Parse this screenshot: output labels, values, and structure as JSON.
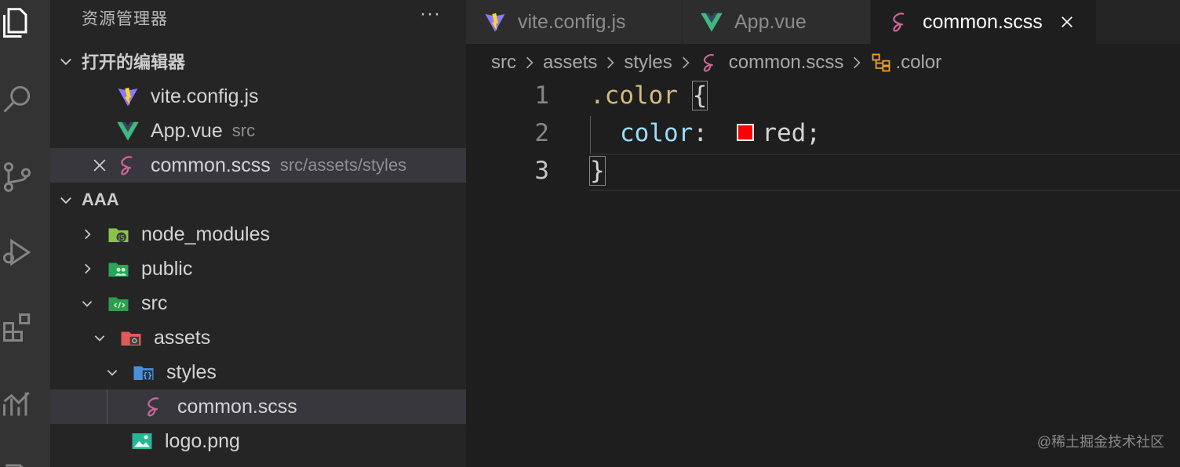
{
  "explorer": {
    "title": "资源管理器",
    "more": "···",
    "open_editors_label": "打开的编辑器",
    "open_editors": [
      {
        "name": "vite.config.js",
        "desc": ""
      },
      {
        "name": "App.vue",
        "desc": "src"
      },
      {
        "name": "common.scss",
        "desc": "src/assets/styles"
      }
    ],
    "workspace_label": "AAA",
    "tree": [
      {
        "name": "node_modules"
      },
      {
        "name": "public"
      },
      {
        "name": "src"
      },
      {
        "name": "assets"
      },
      {
        "name": "styles"
      },
      {
        "name": "common.scss"
      },
      {
        "name": "logo.png"
      }
    ]
  },
  "tabs": [
    {
      "label": "vite.config.js",
      "icon": "vite-icon"
    },
    {
      "label": "App.vue",
      "icon": "vue-icon"
    },
    {
      "label": "common.scss",
      "icon": "sass-icon",
      "active": true
    }
  ],
  "breadcrumbs": [
    "src",
    "assets",
    "styles",
    "common.scss",
    ".color"
  ],
  "editor": {
    "line_numbers": [
      "1",
      "2",
      "3"
    ],
    "line1_selector": ".color",
    "line1_brace": "{",
    "line2_property": "color",
    "line2_colon": ":",
    "line2_value": "red",
    "line2_semicolon": ";",
    "line3_brace": "}"
  },
  "colors": {
    "selector": "#d7ba7d",
    "property": "#9cdcfe",
    "value": "#d4d4d4",
    "swatch": "#ff0000",
    "vue": "#41b883",
    "sass": "#cd6799"
  },
  "watermark": "@稀土掘金技术社区"
}
